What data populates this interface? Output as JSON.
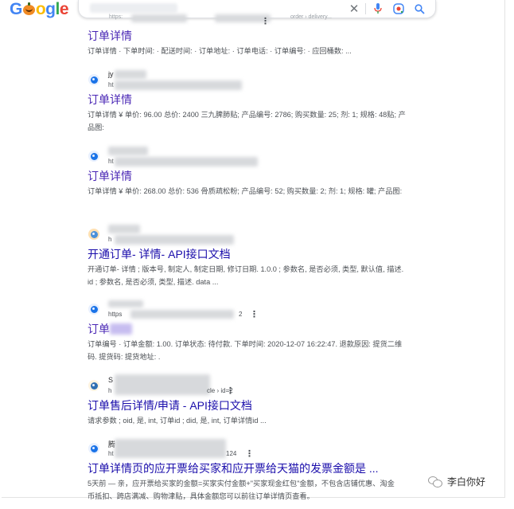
{
  "header": {
    "logo_letters": [
      "G",
      "",
      "o",
      "g",
      "l",
      "e"
    ],
    "logo_colors": [
      "#4285f4",
      "#f08a24",
      "#fbbc05",
      "#4285f4",
      "#34a853",
      "#ea4335"
    ],
    "clear_icon": "close-icon",
    "mic_icon": "microphone-icon",
    "lens_icon": "google-lens-icon",
    "search_icon": "search-icon"
  },
  "results": [
    {
      "url": "https:",
      "url_tail": "order › delivery...",
      "title": "订单详情",
      "snippet": "订单详情 · 下单时间: · 配送时间: · 订单地址: · 订单电话: · 订单编号: · 应回桶数: ..."
    },
    {
      "site_name": "jy",
      "url": "ht",
      "title": "订单详情",
      "snippet": "订单详情 ¥ 单价: 96.00 总价: 2400 三九脾肺贴; 产品编号: 2786; 购买数量: 25; 剂: 1; 规格: 48贴; 产品图:"
    },
    {
      "url": "ht",
      "title": "订单详情",
      "snippet": "订单详情 ¥ 单价: 268.00 总价: 536 骨质疏松粉; 产品编号: 52; 购买数量: 2; 剂: 1; 规格: 罐; 产品图:"
    },
    {
      "url": "h",
      "title": "开通订单- 详情- API接口文档",
      "snippet": "开通订单- 详情 ; 版本号, 制定人, 制定日期, 修订日期. 1.0.0 ; 参数名, 是否必须, 类型, 默认值, 描述. id ; 参数名, 是否必须, 类型, 描述. data ..."
    },
    {
      "url": "https",
      "url_tail": "2",
      "title": "订单",
      "snippet": "订单编号 · 订单金额: 1.00. 订单状态: 待付款. 下单时间: 2020-12-07 16:22:47. 退款原因: 提货二维码. 提货码: 提货地址: ."
    },
    {
      "site_name": "S",
      "url": "h",
      "url_tail": "cle › id=2",
      "title": "订单售后详情/申请 - API接口文档",
      "snippet": "请求参数 ; oid, 是, int, 订单id ; did, 是, int, 订单详情id ..."
    },
    {
      "site_name": "腾",
      "url": "ht",
      "url_tail": "124",
      "title": "订单详情页的应开票给买家和应开票给天猫的发票金额是 ...",
      "snippet": "5天前 — 亲，应开票给买家的金额=买家实付金额+\"买家现金红包\"金额，不包含店铺优惠、淘金币抵扣、跨店满减、购物津贴，具体金额您可以前往订单详情页查看。"
    }
  ],
  "watermark": "李白你好"
}
